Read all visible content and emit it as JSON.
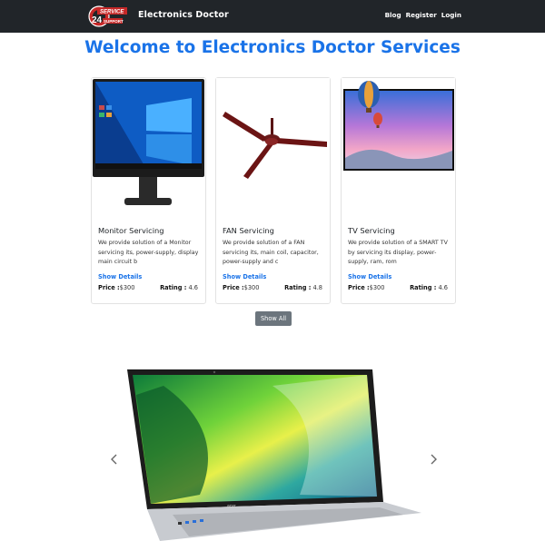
{
  "navbar": {
    "brand_name": "Electronics Doctor",
    "logo": {
      "line1": "SERVICE",
      "line2": "24",
      "line3": "SUPPORT"
    },
    "links": [
      "Blog",
      "Register",
      "Login"
    ]
  },
  "title": "Welcome to Electronics Doctor Services",
  "cards": [
    {
      "title": "Monitor Servicing",
      "desc": "We provide solution of a Monitor servicing its, power-supply, display main circuit b",
      "show_details": "Show Details",
      "price_label": "Price :",
      "price": "$300",
      "rating_label": "Rating :",
      "rating": "4.6",
      "image": "monitor-image"
    },
    {
      "title": "FAN Servicing",
      "desc": "We provide solution of a FAN servicing its, main coil, capacitor, power-supply and c",
      "show_details": "Show Details",
      "price_label": "Price :",
      "price": "$300",
      "rating_label": "Rating :",
      "rating": "4.8",
      "image": "ceiling-fan-image"
    },
    {
      "title": "TV Servicing",
      "desc": "We provide solution of a SMART TV by servicing its display, power-supply, ram, rom",
      "show_details": "Show Details",
      "price_label": "Price :",
      "price": "$300",
      "rating_label": "Rating :",
      "rating": "4.6",
      "image": "tv-image"
    }
  ],
  "show_all": "Show All",
  "carousel": {
    "image": "laptop-image",
    "prev_icon": "chevron-left-icon",
    "next_icon": "chevron-right-icon"
  },
  "colors": {
    "navbar": "#212529",
    "accent": "#1a73e8",
    "button": "#6c757d"
  }
}
